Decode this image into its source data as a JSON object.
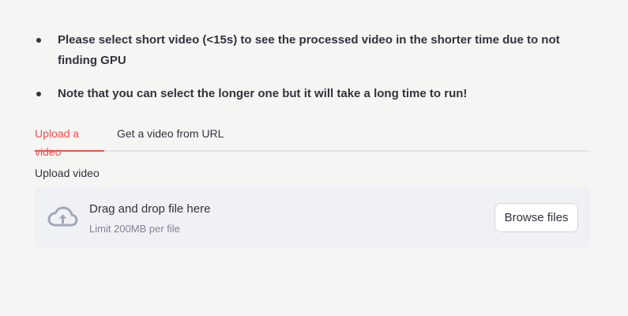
{
  "notes": [
    "Please select short video (<15s) to see the processed video in the shorter time due to not finding GPU",
    "Note that you can select the longer one but it will take a long time to run!"
  ],
  "tabs": [
    {
      "label": "Upload a video",
      "active": true
    },
    {
      "label": "Get a video from URL",
      "active": false
    }
  ],
  "uploader": {
    "label": "Upload video",
    "icon": "cloud-upload-icon",
    "instruction": "Drag and drop file here",
    "limit": "Limit 200MB per file",
    "button_label": "Browse files"
  },
  "colors": {
    "accent": "#ff4b4b",
    "text": "#31333f",
    "muted": "#808495",
    "dropzone_bg": "#f0f1f5",
    "page_bg": "#f5f6f3"
  }
}
